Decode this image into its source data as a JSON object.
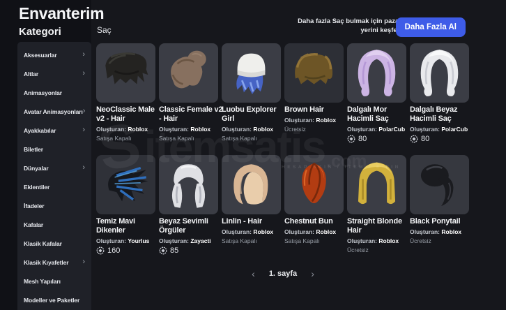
{
  "page": {
    "title": "Envanterim"
  },
  "sidebar": {
    "title": "Kategori",
    "items": [
      {
        "label": "Aksesuarlar",
        "chevron": true
      },
      {
        "label": "Altlar",
        "chevron": true
      },
      {
        "label": "Animasyonlar",
        "chevron": false
      },
      {
        "label": "Avatar Animasyonları",
        "chevron": true
      },
      {
        "label": "Ayakkabılar",
        "chevron": true
      },
      {
        "label": "Biletler",
        "chevron": false
      },
      {
        "label": "Dünyalar",
        "chevron": true
      },
      {
        "label": "Eklentiler",
        "chevron": false
      },
      {
        "label": "İfadeler",
        "chevron": false
      },
      {
        "label": "Kafalar",
        "chevron": false
      },
      {
        "label": "Klasik Kafalar",
        "chevron": false
      },
      {
        "label": "Klasik Kıyafetler",
        "chevron": true
      },
      {
        "label": "Mesh Yapıları",
        "chevron": false
      },
      {
        "label": "Modeller ve Paketler",
        "chevron": false
      }
    ]
  },
  "main": {
    "section_label": "Saç",
    "creator_label": "Oluşturan:",
    "promo": {
      "text_line1": "Daha fazla Saç bulmak için pazar",
      "text_line2": "yerini keşfet!",
      "button_label": "Daha Fazla Al"
    },
    "items": [
      {
        "title": "NeoClassic Male v2 - Hair",
        "creator": "Roblox",
        "status": "Satışa Kapalı",
        "price": null,
        "thumb": {
          "type": "messy",
          "bg": "#3b3d45",
          "colors": [
            "#242321",
            "#45443f",
            "#121110"
          ]
        }
      },
      {
        "title": "Classic Female v2 - Hair",
        "creator": "Roblox",
        "status": "Satışa Kapalı",
        "price": null,
        "thumb": {
          "type": "pigtails",
          "bg": "#3b3d45",
          "colors": [
            "#87705f",
            "#65503e",
            "#9c8673"
          ]
        }
      },
      {
        "title": "Luobu Explorer Girl",
        "creator": "Roblox",
        "status": "Satışa Kapalı",
        "price": null,
        "thumb": {
          "type": "beanie",
          "bg": "#3b3d45",
          "colors": [
            "#efefec",
            "#4663c4",
            "#87a4ec"
          ]
        }
      },
      {
        "title": "Brown Hair",
        "creator": "Roblox",
        "status": "Ücretsiz",
        "price": null,
        "thumb": {
          "type": "swept",
          "bg": "#2d2f36",
          "colors": [
            "#6d5526",
            "#97783a",
            "#473a1a"
          ]
        }
      },
      {
        "title": "Dalgalı Mor Hacimli Saç",
        "creator": "PolarCub",
        "status": null,
        "price": "80",
        "thumb": {
          "type": "wavy",
          "bg": "#3b3d45",
          "colors": [
            "#ccb4e4",
            "#b598d6",
            "#e3d3f2"
          ]
        }
      },
      {
        "title": "Dalgalı Beyaz Hacimli Saç",
        "creator": "PolarCub",
        "status": null,
        "price": "80",
        "thumb": {
          "type": "wavy",
          "bg": "#3b3d45",
          "colors": [
            "#e9eaed",
            "#c9cbd2",
            "#fafbfc"
          ]
        }
      },
      {
        "title": "Temiz Mavi Dikenler",
        "creator": "Yourlus",
        "status": null,
        "price": "160",
        "thumb": {
          "type": "spiky",
          "bg": "#2f3138",
          "colors": [
            "#16181d",
            "#2f6fbd",
            "#5aaae8"
          ]
        }
      },
      {
        "title": "Beyaz Sevimli Örgüler",
        "creator": "Zayacti",
        "status": null,
        "price": "85",
        "thumb": {
          "type": "braids",
          "bg": "#3b3d45",
          "colors": [
            "#dfe0e4",
            "#b2b4bd",
            "#f3f4f6"
          ]
        }
      },
      {
        "title": "Linlin - Hair",
        "creator": "Roblox",
        "status": "Satışa Kapalı",
        "price": null,
        "thumb": {
          "type": "bob",
          "bg": "#3b3d45",
          "colors": [
            "#d9b694",
            "#c2States",
            "#e9cdab"
          ]
        }
      },
      {
        "title": "Chestnut Bun",
        "creator": "Roblox",
        "status": "Satışa Kapalı",
        "price": null,
        "thumb": {
          "type": "bun",
          "bg": "#3b3d45",
          "colors": [
            "#b23c12",
            "#e56f2d",
            "#77280b"
          ]
        }
      },
      {
        "title": "Straight Blonde Hair",
        "creator": "Roblox",
        "status": "Ücretsiz",
        "price": null,
        "thumb": {
          "type": "straight",
          "bg": "#3b3d45",
          "colors": [
            "#d2b13c",
            "#ab8c28",
            "#e9cd60"
          ]
        }
      },
      {
        "title": "Black Ponytail",
        "creator": "Roblox",
        "status": "Ücretsiz",
        "price": null,
        "thumb": {
          "type": "ponytail",
          "bg": "#36383f",
          "colors": [
            "#1a1b1f",
            "#3d3f46",
            "#0e0f12"
          ]
        }
      }
    ],
    "pagination": {
      "prev": "‹",
      "label": "1. sayfa",
      "next": "›"
    }
  },
  "watermark": {
    "logo": "S",
    "text": "itemsatis",
    "suffix": ".com",
    "tagline": "HESAP SKIN / ITEM / E-PIN"
  },
  "colors": {
    "accent_blue": "#3e5ce8",
    "thumb_bg": "#3b3d45",
    "sidebar_bg": "#1f2128",
    "page_bg": "#101116",
    "main_bg": "#16171c"
  }
}
